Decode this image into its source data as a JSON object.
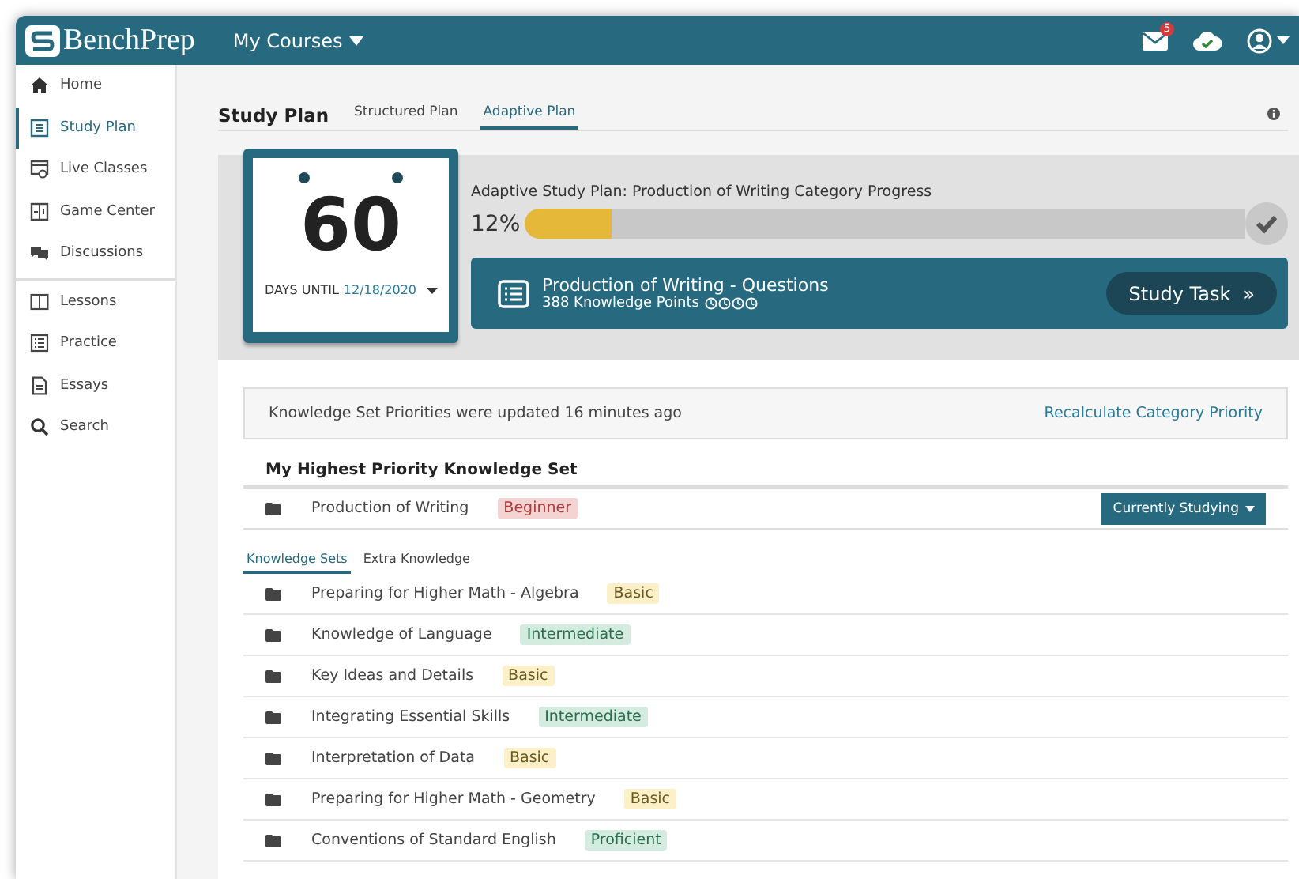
{
  "header": {
    "logo": "BenchPrep",
    "menu": "My Courses",
    "mail_badge": "5"
  },
  "sidebar": {
    "groups": [
      [
        {
          "label": "Home",
          "kind": "home",
          "selected": false
        },
        {
          "label": "Study Plan",
          "kind": "plan",
          "selected": true
        },
        {
          "label": "Live Classes",
          "kind": "live",
          "selected": false
        },
        {
          "label": "Game Center",
          "kind": "game",
          "selected": false
        },
        {
          "label": "Discussions",
          "kind": "chat",
          "selected": false
        }
      ],
      [
        {
          "label": "Lessons",
          "kind": "book",
          "selected": false
        },
        {
          "label": "Practice",
          "kind": "list",
          "selected": false
        },
        {
          "label": "Essays",
          "kind": "doc",
          "selected": false
        },
        {
          "label": "Search",
          "kind": "search",
          "selected": false
        }
      ]
    ]
  },
  "page": {
    "title": "Study Plan",
    "tabs": [
      {
        "label": "Structured Plan",
        "selected": false
      },
      {
        "label": "Adaptive Plan",
        "selected": true
      }
    ]
  },
  "countdown": {
    "days": "60",
    "label": "DAYS UNTIL",
    "date": "12/18/2020"
  },
  "progress": {
    "title": "Adaptive Study Plan: Production of Writing Category Progress",
    "percent": "12%",
    "level": 0.12
  },
  "task": {
    "title": "Production of Writing - Questions",
    "subtitle": "388 Knowledge Points",
    "button": "Study Task",
    "chevron": "»"
  },
  "notice": {
    "text": "Knowledge Set Priorities were updated 16 minutes ago",
    "link": "Recalculate Category Priority"
  },
  "priority": {
    "heading": "My Highest Priority Knowledge Set",
    "name": "Production of Writing",
    "tag": "Beginner",
    "color": "#f4d3d3",
    "button": "Currently Studying"
  },
  "set_tabs": [
    {
      "label": "Knowledge Sets",
      "selected": true
    },
    {
      "label": "Extra Knowledge",
      "selected": false
    }
  ],
  "sets": [
    {
      "name": "Preparing for Higher Math - Algebra",
      "tag": "Basic",
      "color": "#fbf0c8"
    },
    {
      "name": "Knowledge of Language",
      "tag": "Intermediate",
      "color": "#d4ebdf"
    },
    {
      "name": "Key Ideas and Details",
      "tag": "Basic",
      "color": "#fbf0c8"
    },
    {
      "name": "Integrating Essential Skills",
      "tag": "Intermediate",
      "color": "#d4ebdf"
    },
    {
      "name": "Interpretation of Data",
      "tag": "Basic",
      "color": "#fbf0c8"
    },
    {
      "name": "Preparing for Higher Math - Geometry",
      "tag": "Basic",
      "color": "#fbf0c8"
    },
    {
      "name": "Conventions of Standard English",
      "tag": "Proficient",
      "color": "#d4ebdf"
    }
  ]
}
